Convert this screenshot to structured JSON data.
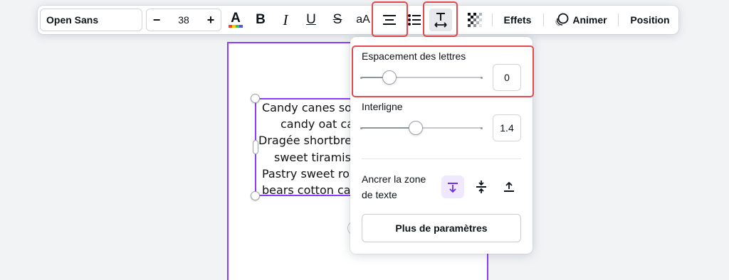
{
  "toolbar": {
    "font_family": "Open Sans",
    "font_size": "38",
    "size_minus": "−",
    "size_plus": "+",
    "bold_glyph": "B",
    "italic_glyph": "I",
    "underline_glyph": "U",
    "strike_glyph": "S",
    "case_glyph": "aA",
    "effects_label": "Effets",
    "animate_label": "Animer",
    "position_label": "Position"
  },
  "canvas": {
    "text_lines": [
      "Candy canes sou",
      "candy oat cake",
      "Dragée shortbre",
      "sweet tiramisu",
      "Pastry sweet rol",
      "bears cotton car"
    ]
  },
  "spacing_popover": {
    "letter_spacing": {
      "label": "Espacement des lettres",
      "value": "0",
      "fraction": 0.23
    },
    "line_height": {
      "label": "Interligne",
      "value": "1.4",
      "fraction": 0.45
    },
    "anchor_label_line1": "Ancrer la zone",
    "anchor_label_line2": "de texte",
    "anchor_options": [
      "top",
      "middle",
      "bottom"
    ],
    "anchor_selected": "top",
    "more_button_label": "Plus de paramètres"
  },
  "colors": {
    "accent_purple": "#8b3dff",
    "highlight_red": "#e5484d",
    "text_color_bar": "rainbow"
  }
}
